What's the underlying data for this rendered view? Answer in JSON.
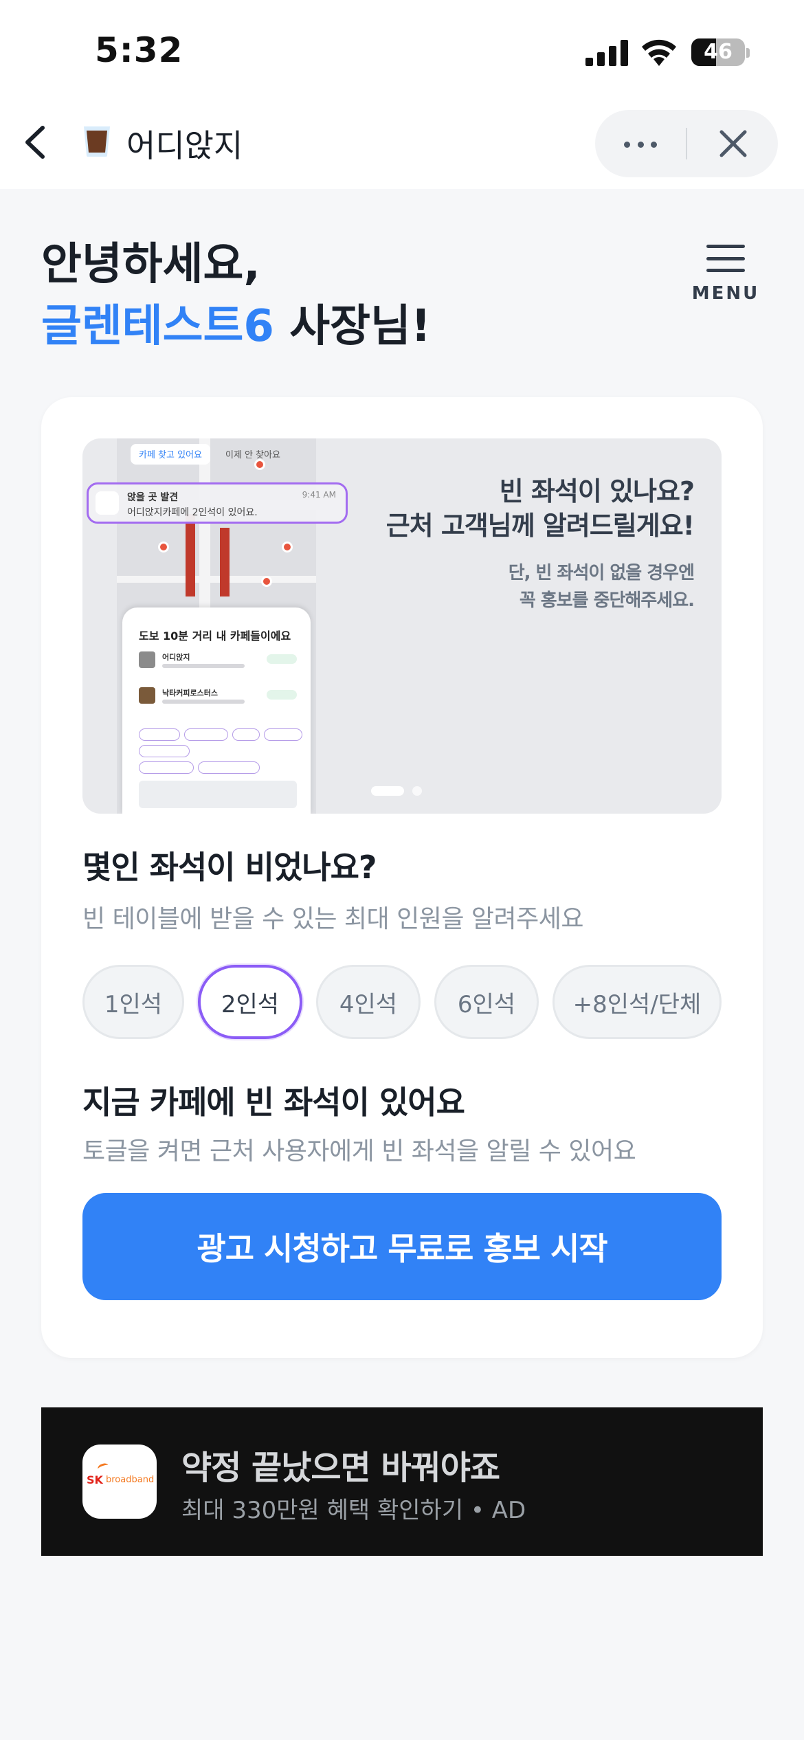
{
  "status_bar": {
    "time": "5:32",
    "battery": "46",
    "battery_level": 0.46
  },
  "nav": {
    "title": "어디앉지"
  },
  "greeting": {
    "line1": "안녕하세요,",
    "name": "글렌테스트6",
    "suffix": " 사장님!"
  },
  "menu": {
    "label": "MENU"
  },
  "banner": {
    "title_line1": "빈 좌석이 있나요?",
    "title_line2": "근처 고객님께 알려드릴게요!",
    "sub_line1": "단, 빈 좌석이 없을 경우엔",
    "sub_line2": "꼭 홍보를 중단해주세요.",
    "map_tab_active": "카페 찾고 있어요",
    "map_tab_other": "이제 안 찾아요",
    "notification_title": "앉을 곳 발견",
    "notification_body": "어디앉지카페에 2인석이 있어요.",
    "notification_time": "9:41 AM",
    "sheet_title": "도보 10분 거리 내 카페들이에요",
    "sheet_item1": "어디앉지",
    "sheet_item2": "낙타커피로스터스",
    "page_index": 1,
    "page_count": 2
  },
  "seat_section": {
    "title": "몇인 좌석이 비었나요?",
    "subtitle": "빈 테이블에 받을 수 있는 최대 인원을 알려주세요",
    "options": [
      "1인석",
      "2인석",
      "4인석",
      "6인석",
      "+8인석/단체"
    ],
    "selected": "2인석"
  },
  "toggle_section": {
    "title": "지금 카페에 빈 좌석이 있어요",
    "subtitle": "토글을 켜면 근처 사용자에게 빈 좌석을 알릴 수 있어요"
  },
  "cta": {
    "label": "광고 시청하고 무료로 홍보 시작"
  },
  "ad": {
    "logo_sk": "SK",
    "logo_text": "broadband",
    "title": "약정 끝났으면 바꿔야죠",
    "subtitle": "최대 330만원 혜택 확인하기 • AD"
  },
  "colors": {
    "accent": "#3182f6",
    "selected_border": "#8b5cf6",
    "ad_bg": "#111111"
  },
  "icons": [
    "back-icon",
    "app-icon",
    "more-icon",
    "close-icon",
    "menu-icon",
    "signal-icon",
    "wifi-icon",
    "battery-icon"
  ]
}
